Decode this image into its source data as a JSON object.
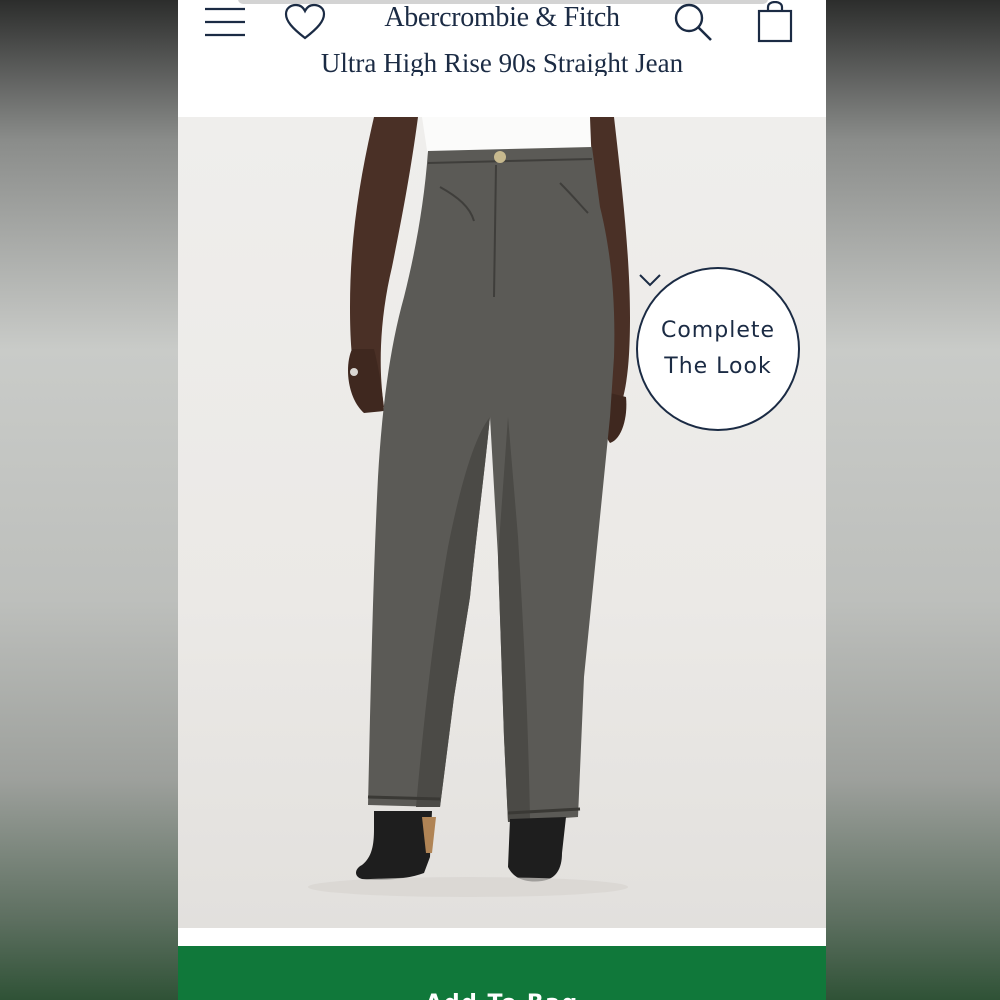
{
  "header": {
    "brand": "Abercrombie & Fitch",
    "icons": [
      "menu-icon",
      "heart-icon",
      "search-icon",
      "shopping-bag-icon"
    ]
  },
  "product": {
    "title": "Ultra High Rise 90s Straight Jean"
  },
  "complete_look": {
    "line1": "Complete",
    "line2": "The Look"
  },
  "cta": {
    "add_to_bag": "Add To Bag"
  },
  "colors": {
    "brand_navy": "#1b2b44",
    "cta_green": "#10783a",
    "denim_gray": "#5b5a56"
  }
}
